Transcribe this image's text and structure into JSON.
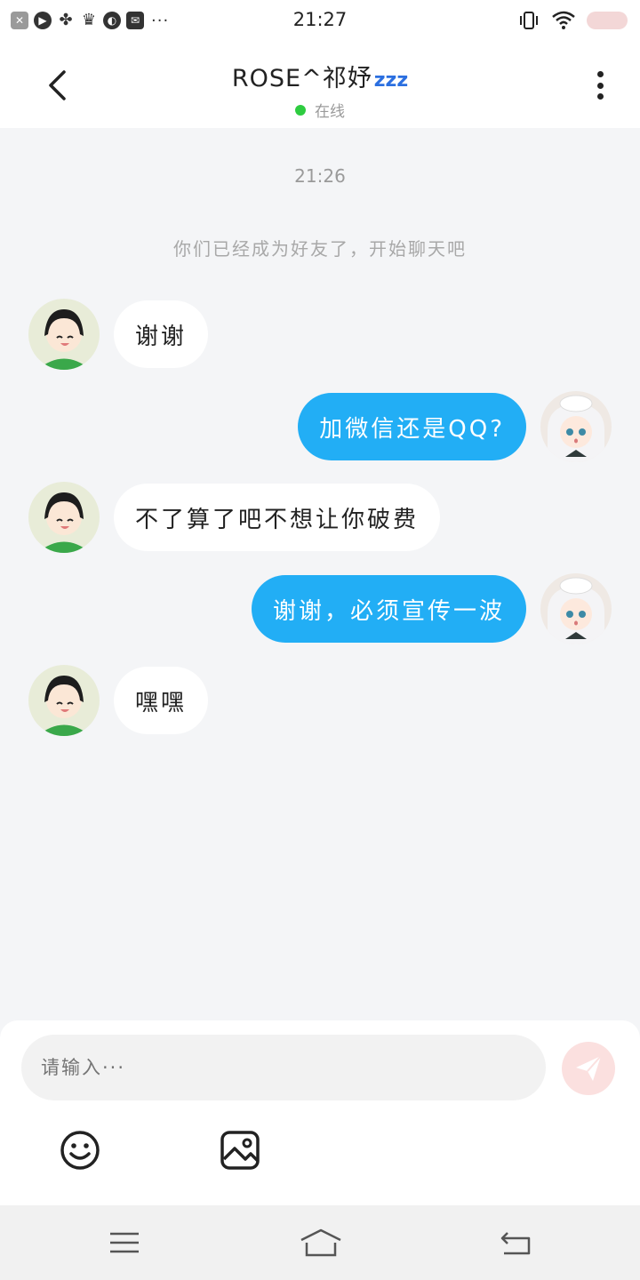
{
  "status_bar": {
    "time": "21:27",
    "left_icons": [
      "close-icon",
      "play-icon",
      "fan-icon",
      "crown-icon",
      "planet-icon",
      "mail-icon"
    ],
    "more_dots": "···",
    "right_icons": [
      "vibrate-icon",
      "wifi-icon",
      "battery-icon"
    ],
    "battery_color": "#f3d7d7"
  },
  "header": {
    "title": "ROSE^祁妤",
    "title_emoji": "zzz",
    "status": "在线",
    "status_color": "#2ecc40"
  },
  "chat": {
    "time_label": "21:26",
    "system_message": "你们已经成为好友了，开始聊天吧",
    "messages": [
      {
        "direction": "in",
        "text": "谢谢"
      },
      {
        "direction": "out",
        "text": "加微信还是QQ?"
      },
      {
        "direction": "in",
        "text": "不了算了吧不想让你破费"
      },
      {
        "direction": "out",
        "text": "谢谢，必须宣传一波"
      },
      {
        "direction": "in",
        "text": "嘿嘿"
      }
    ],
    "outgoing_bubble_color": "#22aef5",
    "incoming_bubble_color": "#ffffff"
  },
  "input": {
    "placeholder": "请输入···",
    "send_button_color": "#fbe0df",
    "toolbar_icons": [
      "emoji-icon",
      "image-icon"
    ]
  },
  "nav_bar": {
    "buttons": [
      "menu-icon",
      "home-icon",
      "back-icon"
    ]
  }
}
